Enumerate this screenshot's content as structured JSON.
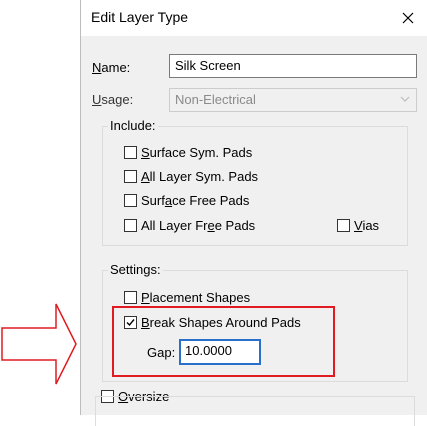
{
  "dialog": {
    "title": "Edit Layer Type",
    "name_label": {
      "pre": "",
      "u": "N",
      "post": "ame:"
    },
    "name_value": "Silk Screen",
    "usage_label": {
      "pre": "",
      "u": "U",
      "post": "sage:"
    },
    "usage_value": "Non-Electrical",
    "include": {
      "title": "Include:",
      "items": [
        {
          "pre": "",
          "u": "S",
          "post": "urface Sym. Pads",
          "checked": false
        },
        {
          "pre": "",
          "u": "A",
          "post": "ll Layer Sym. Pads",
          "checked": false
        },
        {
          "pre": "Surf",
          "u": "a",
          "post": "ce Free Pads",
          "checked": false
        },
        {
          "pre": "All Layer Fr",
          "u": "e",
          "post": "e Pads",
          "checked": false
        },
        {
          "pre": "",
          "u": "V",
          "post": "ias",
          "checked": false
        }
      ]
    },
    "settings": {
      "title": "Settings:",
      "placement": {
        "pre": "",
        "u": "P",
        "post": "lacement Shapes",
        "checked": false
      },
      "break_shapes": {
        "pre": "",
        "u": "B",
        "post": "reak Shapes Around Pads",
        "checked": true
      },
      "gap_label": "Gap:",
      "gap_value": "10.0000"
    },
    "oversize": {
      "pre": "",
      "u": "O",
      "post": "versize",
      "checked": false
    }
  },
  "colors": {
    "highlight": "#e21b23",
    "arrow": "#e21b23",
    "focus": "#2a6fc9"
  }
}
